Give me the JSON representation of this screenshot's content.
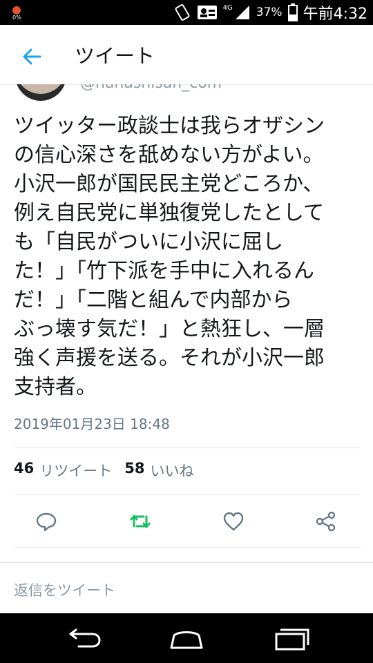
{
  "status_bar": {
    "network": "4G",
    "battery": "37%",
    "time": "午前4:32"
  },
  "header": {
    "title": "ツイート"
  },
  "author": {
    "handle": "@nanashisan_com"
  },
  "tweet": {
    "lines": [
      "ツイッター政談士は我らオザシン",
      "の信心深さを舐めない方がよい。",
      "小沢一郎が国民民主党どころか、",
      "例え自民党に単独復党したとして",
      "も「自民がついに小沢に屈し",
      "た！」「竹下派を手中に入れるん",
      "だ！」「二階と組んで内部から",
      "ぶっ壊す気だ！」と熱狂し、一層",
      "強く声援を送る。それが小沢一郎",
      "支持者。"
    ],
    "timestamp": "2019年01月23日 18:48"
  },
  "stats": {
    "retweets_count": "46",
    "retweets_label": "リツイート",
    "likes_count": "58",
    "likes_label": "いいね"
  },
  "actions": {
    "reply_icon": "reply-icon",
    "retweet_icon": "retweet-icon",
    "like_icon": "heart-icon",
    "share_icon": "share-icon"
  },
  "reply_bar": {
    "placeholder": "返信をツイート"
  },
  "colors": {
    "accent": "#1da1f2",
    "retweet": "#17bf63",
    "text": "#14171a",
    "muted": "#657786"
  }
}
